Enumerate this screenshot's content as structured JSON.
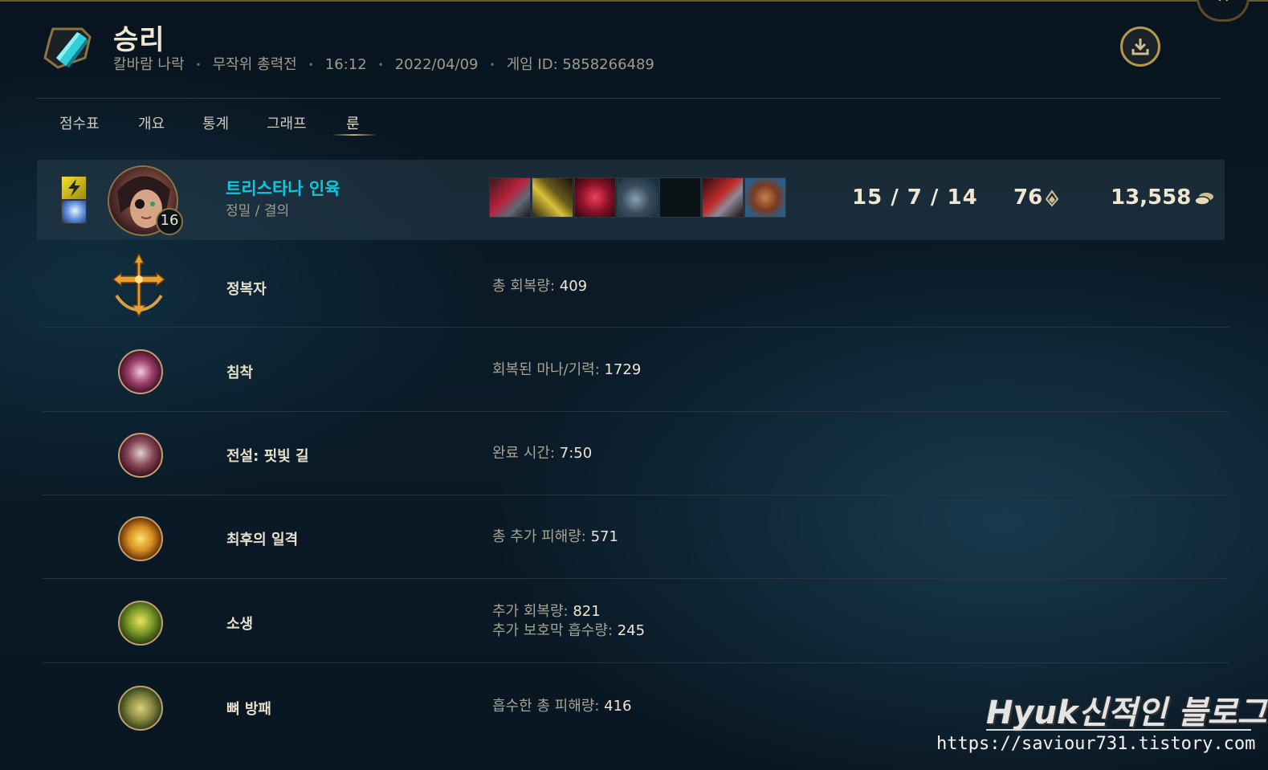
{
  "header": {
    "result": "승리",
    "map": "칼바람 나락",
    "mode": "무작위 총력전",
    "duration": "16:12",
    "date": "2022/04/09",
    "game_id": "게임 ID: 5858266489",
    "download_icon": "download-icon",
    "close_icon": "close-icon"
  },
  "tabs": [
    {
      "label": "점수표",
      "active": false
    },
    {
      "label": "개요",
      "active": false
    },
    {
      "label": "통계",
      "active": false
    },
    {
      "label": "그래프",
      "active": false
    },
    {
      "label": "룬",
      "active": true
    }
  ],
  "player": {
    "name": "트리스타나 인육",
    "rune_trees": "정밀 / 결의",
    "level": "16",
    "kda": "15 / 7 / 14",
    "cs": "76",
    "gold": "13,558",
    "summoner_spells": [
      "flash-spell-icon",
      "mark-spell-icon"
    ],
    "items": [
      "item-1-icon",
      "item-2-icon",
      "item-3-icon",
      "item-4-icon",
      "empty-slot",
      "item-6-icon",
      "trinket-icon"
    ],
    "colors": {
      "name": "#0ac8e0"
    }
  },
  "runes": [
    {
      "name": "정복자",
      "icon": "conqueror-icon",
      "stats": [
        {
          "label": "총 회복량: ",
          "value": "409"
        }
      ]
    },
    {
      "name": "침착",
      "icon": "presence-of-mind-icon",
      "stats": [
        {
          "label": "회복된 마나/기력: ",
          "value": "1729"
        }
      ]
    },
    {
      "name": "전설: 핏빛 길",
      "icon": "legend-bloodline-icon",
      "stats": [
        {
          "label": "완료 시간: ",
          "value": "7:50"
        }
      ]
    },
    {
      "name": "최후의 일격",
      "icon": "coup-de-grace-icon",
      "stats": [
        {
          "label": "총 추가 피해량: ",
          "value": "571"
        }
      ]
    },
    {
      "name": "소생",
      "icon": "revitalize-icon",
      "stats": [
        {
          "label": "추가 회복량: ",
          "value": "821"
        },
        {
          "label": "추가 보호막 흡수량: ",
          "value": "245"
        }
      ]
    },
    {
      "name": "뼈 방패",
      "icon": "bone-plating-icon",
      "stats": [
        {
          "label": "흡수한 총 피해량: ",
          "value": "416"
        }
      ]
    }
  ],
  "watermark": {
    "title": "Hyuk신적인 블로그",
    "url": "https://saviour731.tistory.com"
  }
}
